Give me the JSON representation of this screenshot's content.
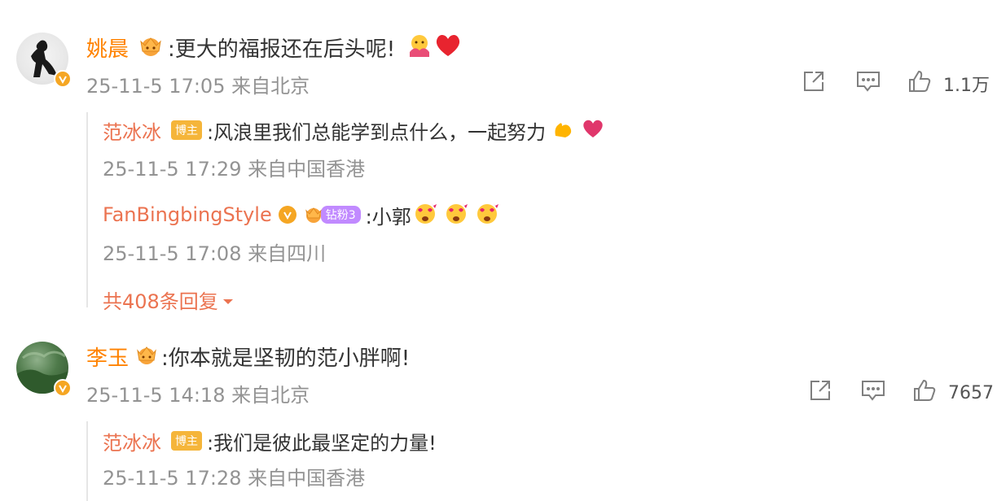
{
  "comments": [
    {
      "user": "姚晨",
      "text": ":更大的福报还在后头呢!",
      "meta": "25-11-5 17:05 来自北京",
      "likes": "1.1万",
      "replies": [
        {
          "user": "范冰冰",
          "tag": "博主",
          "text": ":风浪里我们总能学到点什么，一起努力",
          "meta": "25-11-5 17:29 来自中国香港"
        },
        {
          "user": "FanBingbingStyle",
          "tag": "钻粉3",
          "text": ":小郭",
          "meta": "25-11-5 17:08 来自四川"
        }
      ],
      "more_replies": "共408条回复"
    },
    {
      "user": "李玉",
      "text": ":你本就是坚韧的范小胖啊!",
      "meta": "25-11-5 14:18 来自北京",
      "likes": "7657",
      "replies": [
        {
          "user": "范冰冰",
          "tag": "博主",
          "text": ":我们是彼此最坚定的力量!",
          "meta": "25-11-5 17:28 来自中国香港"
        }
      ]
    }
  ],
  "icons": {
    "share": "share-icon",
    "comment": "comment-icon",
    "like": "like-icon"
  },
  "colors": {
    "username": "#ff8200",
    "reply_name": "#eb7350",
    "meta": "#939393",
    "badge": "#f5a623"
  }
}
